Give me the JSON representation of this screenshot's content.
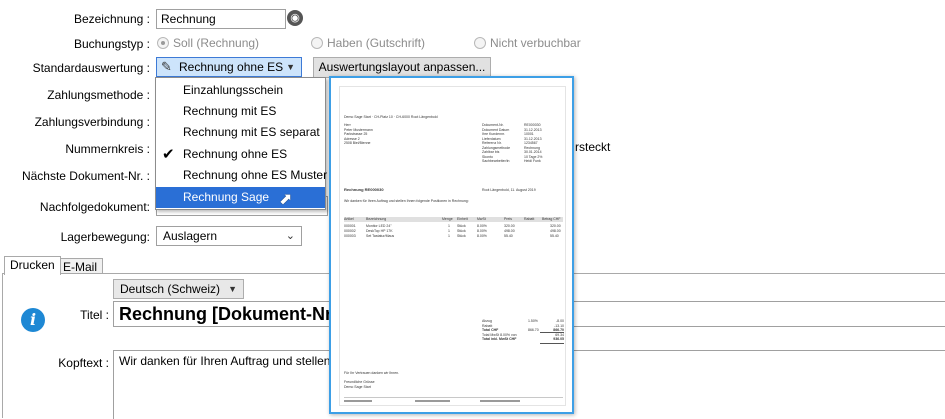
{
  "form": {
    "bezeichnung_label": "Bezeichnung :",
    "bezeichnung_value": "Rechnung",
    "buchungstyp_label": "Buchungstyp :",
    "buchungstyp_options": [
      "Soll (Rechnung)",
      "Haben (Gutschrift)",
      "Nicht verbuchbar"
    ],
    "standardauswertung_label": "Standardauswertung :",
    "standardauswertung_value": "Rechnung ohne ES",
    "auswertungslayout_button": "Auswertungslayout anpassen...",
    "zahlungsmethode_label": "Zahlungsmethode :",
    "zahlungsverbindung_label": "Zahlungsverbindung :",
    "nummernkreis_label": "Nummernkreis :",
    "naechste_label": "Nächste Dokument-Nr. :",
    "nachfolge_label": "Nachfolgedokument:",
    "lager_label": "Lagerbewegung:",
    "lager_value": "Auslagern",
    "versteckt_fragment": "rsteckt"
  },
  "dropdown": {
    "items": [
      "Einzahlungsschein",
      "Rechnung mit ES",
      "Rechnung mit ES separat",
      "Rechnung ohne ES",
      "Rechnung ohne ES Muster",
      "Rechnung Sage"
    ],
    "checked_index": 3,
    "selected_index": 5
  },
  "tabs": [
    "Drucken",
    "E-Mail"
  ],
  "drucken": {
    "language": "Deutsch (Schweiz)",
    "titel_label": "Titel :",
    "titel_value": "Rechnung [Dokument-Nr.\\Be",
    "kopftext_label": "Kopftext :",
    "kopftext_value": "Wir danken für Ihren Auftrag und stellen Ihnen"
  },
  "preview": {
    "header_line": "Demo Sage Start · CH-Platz 10 · CH-6000 Root Längenbold",
    "recipient": [
      "Herr",
      "Peter Mustermann",
      "Parkstrasse 25",
      "Adresse 2",
      "2508 Biel/Bienne"
    ],
    "meta_labels": [
      "Dokument-Nr.",
      "Dokument Datum",
      "Ihre Kundennr.",
      "Lieferdatum",
      "Referenz Nr.",
      "Zahlungsmethode",
      "Zahlbar bis",
      "Skonto",
      "Sachbearbeiter/in"
    ],
    "meta_values": [
      "RE000030",
      "31.12.2013",
      "10001",
      "31.12.2013",
      "1234567",
      "Rechnung",
      "30.01.2014",
      "10 Tage 2%",
      "Heidi Funk"
    ],
    "title": "Rechnung RE000030",
    "place_date": "Root Längenbold, 11. August 2019",
    "intro": "Wir danken für Ihren Auftrag und stellen Ihnen folgende Positionen in Rechnung:",
    "columns": [
      "Artikel",
      "Bezeichnung",
      "Menge",
      "Einheit",
      "MwSt",
      "Preis",
      "Rabatt",
      "Betrag CHF"
    ],
    "rows": [
      [
        "000001",
        "Monitor LED 24\"",
        "1",
        "Stück",
        "8.00%",
        "320.00",
        "",
        "320.00"
      ],
      [
        "000002",
        "DeskTop HP 17K",
        "1",
        "Stück",
        "8.00%",
        "498.00",
        "",
        "498.00"
      ],
      [
        "000003",
        "Set Tastatur/Maus",
        "1",
        "Stück",
        "8.00%",
        "55.40",
        "",
        "55.40"
      ]
    ],
    "totals_labels": [
      "Abzug",
      "Rabatt",
      "Total CHF",
      "Total MwSt 8.00% von",
      "Total inkl. MwSt CHF"
    ],
    "totals_values": [
      "-8.00",
      "-13.10",
      "866.70",
      "69.34",
      "936.05"
    ],
    "totals_mid": [
      "",
      "1.50%",
      "",
      "866.70",
      ""
    ],
    "closing": "Für Ihr Vertrauen danken wir Ihnen.",
    "greeting": [
      "Freundliche Grüsse",
      "Demo Sage Start"
    ]
  },
  "colors": {
    "accent": "#3d9fe6",
    "selection": "#2a6fd6",
    "info": "#1e88d4"
  }
}
